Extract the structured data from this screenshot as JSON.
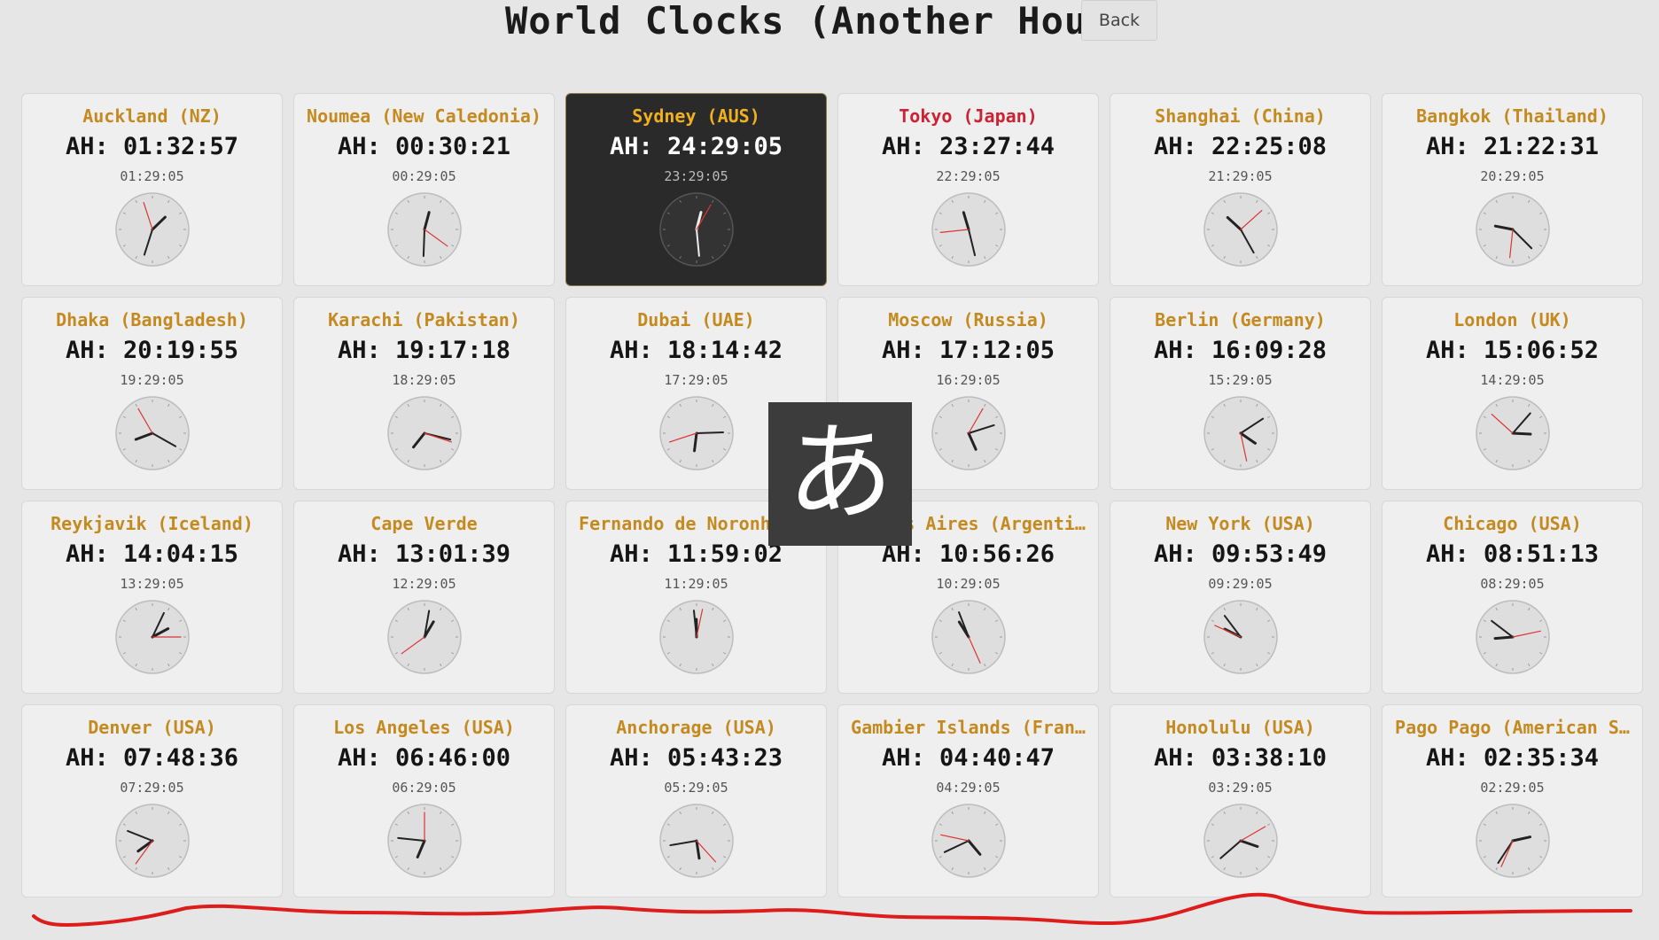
{
  "header": {
    "title": "World Clocks (Another Hour)",
    "back_label": "Back"
  },
  "clocks": [
    {
      "city": "Auckland (NZ)",
      "ah": "AH: 01:32:57",
      "local": "01:29:05"
    },
    {
      "city": "Noumea (New Caledonia)",
      "ah": "AH: 00:30:21",
      "local": "00:29:05"
    },
    {
      "city": "Sydney (AUS)",
      "ah": "AH: 24:29:05",
      "local": "23:29:05",
      "highlight": true
    },
    {
      "city": "Tokyo (Japan)",
      "ah": "AH: 23:27:44",
      "local": "22:29:05",
      "red": true
    },
    {
      "city": "Shanghai (China)",
      "ah": "AH: 22:25:08",
      "local": "21:29:05"
    },
    {
      "city": "Bangkok (Thailand)",
      "ah": "AH: 21:22:31",
      "local": "20:29:05"
    },
    {
      "city": "Dhaka (Bangladesh)",
      "ah": "AH: 20:19:55",
      "local": "19:29:05"
    },
    {
      "city": "Karachi (Pakistan)",
      "ah": "AH: 19:17:18",
      "local": "18:29:05"
    },
    {
      "city": "Dubai (UAE)",
      "ah": "AH: 18:14:42",
      "local": "17:29:05"
    },
    {
      "city": "Moscow (Russia)",
      "ah": "AH: 17:12:05",
      "local": "16:29:05"
    },
    {
      "city": "Berlin (Germany)",
      "ah": "AH: 16:09:28",
      "local": "15:29:05"
    },
    {
      "city": "London (UK)",
      "ah": "AH: 15:06:52",
      "local": "14:29:05"
    },
    {
      "city": "Reykjavik (Iceland)",
      "ah": "AH: 14:04:15",
      "local": "13:29:05"
    },
    {
      "city": "Cape Verde",
      "ah": "AH: 13:01:39",
      "local": "12:29:05"
    },
    {
      "city": "Fernando de Noronha (…",
      "ah": "AH: 11:59:02",
      "local": "11:29:05"
    },
    {
      "city": "Buenos Aires (Argenti…",
      "ah": "AH: 10:56:26",
      "local": "10:29:05"
    },
    {
      "city": "New York (USA)",
      "ah": "AH: 09:53:49",
      "local": "09:29:05"
    },
    {
      "city": "Chicago (USA)",
      "ah": "AH: 08:51:13",
      "local": "08:29:05"
    },
    {
      "city": "Denver (USA)",
      "ah": "AH: 07:48:36",
      "local": "07:29:05"
    },
    {
      "city": "Los Angeles (USA)",
      "ah": "AH: 06:46:00",
      "local": "06:29:05"
    },
    {
      "city": "Anchorage (USA)",
      "ah": "AH: 05:43:23",
      "local": "05:29:05"
    },
    {
      "city": "Gambier Islands (Fran…",
      "ah": "AH: 04:40:47",
      "local": "04:29:05"
    },
    {
      "city": "Honolulu (USA)",
      "ah": "AH: 03:38:10",
      "local": "03:29:05"
    },
    {
      "city": "Pago Pago (American S…",
      "ah": "AH: 02:35:34",
      "local": "02:29:05"
    }
  ],
  "ime_indicator": {
    "glyph": "あ"
  },
  "colors": {
    "accent_gold": "#c58a1f",
    "accent_red": "#cc2233",
    "highlight_bg": "#2a2a2a",
    "annotation_red": "#dd1c1c"
  }
}
